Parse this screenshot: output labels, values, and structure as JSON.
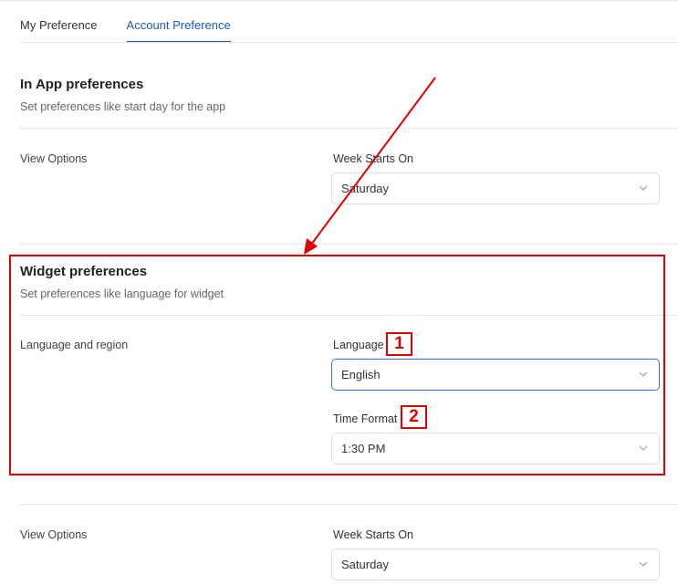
{
  "tabs": [
    {
      "label": "My Preference",
      "active": false
    },
    {
      "label": "Account Preference",
      "active": true
    }
  ],
  "in_app": {
    "title": "In App preferences",
    "subtitle": "Set preferences like start day for the app",
    "row_label": "View Options",
    "week_label": "Week Starts On",
    "week_value": "Saturday"
  },
  "widget": {
    "title": "Widget preferences",
    "subtitle": "Set preferences like language for widget",
    "row_label": "Language and region",
    "language_label": "Language",
    "language_value": "English",
    "time_label": "Time Format",
    "time_value": "1:30 PM"
  },
  "lower": {
    "row_label": "View Options",
    "week_label": "Week Starts On",
    "week_value": "Saturday"
  },
  "annotations": {
    "badge_1": "1",
    "badge_2": "2",
    "color": "#e00000"
  },
  "colors": {
    "accent": "#1a5bbf",
    "focus_border": "#3b6fd6"
  }
}
